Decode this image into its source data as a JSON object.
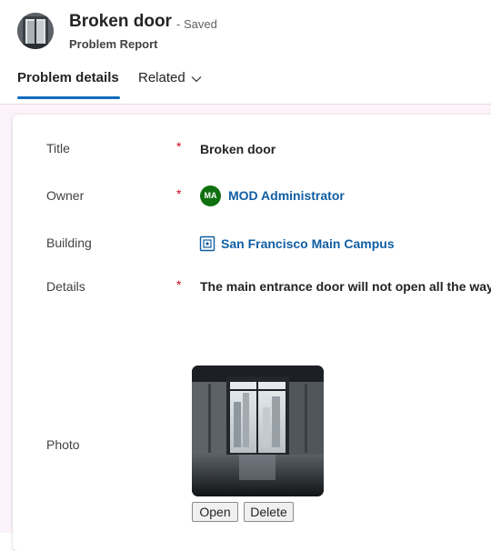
{
  "header": {
    "title": "Broken door",
    "status": "- Saved",
    "entity": "Problem Report"
  },
  "tabs": [
    {
      "label": "Problem details",
      "active": true
    },
    {
      "label": "Related",
      "active": false
    }
  ],
  "form": {
    "fields": {
      "title": {
        "label": "Title",
        "required": "*",
        "value": "Broken door"
      },
      "owner": {
        "label": "Owner",
        "required": "*",
        "initials": "MA",
        "value": "MOD Administrator"
      },
      "building": {
        "label": "Building",
        "value": "San Francisco Main Campus"
      },
      "details": {
        "label": "Details",
        "required": "*",
        "value": "The main entrance door will not open all the way"
      },
      "photo": {
        "label": "Photo",
        "open_label": "Open",
        "delete_label": "Delete"
      }
    }
  },
  "colors": {
    "accent": "#0f6cbd",
    "link": "#115ea3",
    "required": "#c50f1f",
    "avatar_bg": "#0e700e"
  },
  "icons": [
    "record-image-icon",
    "chevron-down-icon",
    "building-icon"
  ]
}
